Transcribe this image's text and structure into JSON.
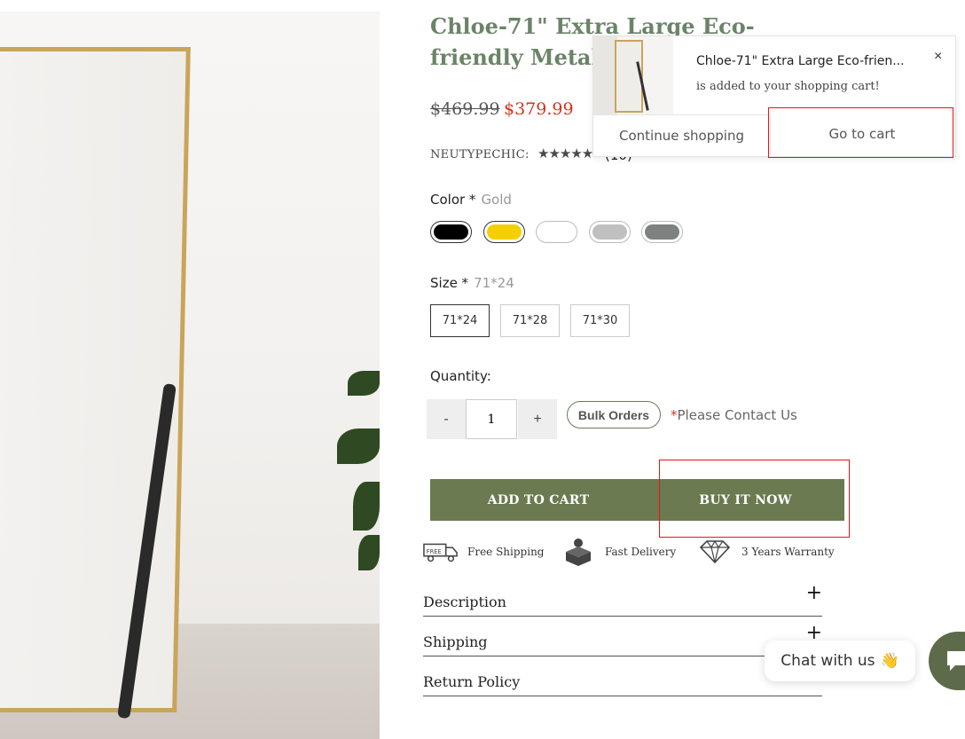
{
  "product": {
    "title": "Chloe-71\" Extra Large Eco-friendly Metal Framed Fu",
    "price_old": "$469.99",
    "price_new": "$379.99",
    "vendor": "NEUTYPECHIC:",
    "rating": 5,
    "stars": "★★★★★",
    "review_count": "(10)"
  },
  "color": {
    "label": "Color *",
    "selected": "Gold",
    "swatches": [
      {
        "name": "Black",
        "hex": "#000000"
      },
      {
        "name": "Gold",
        "hex": "#f5d000"
      },
      {
        "name": "White",
        "hex": "#ffffff"
      },
      {
        "name": "Silver",
        "hex": "#c0c0c0"
      },
      {
        "name": "Gray",
        "hex": "#7e8180"
      }
    ]
  },
  "size": {
    "label": "Size *",
    "selected": "71*24",
    "options": [
      "71*24",
      "71*28",
      "71*30"
    ]
  },
  "quantity": {
    "label": "Quantity:",
    "value": "1",
    "minus": "-",
    "plus": "+"
  },
  "bulk": {
    "button": "Bulk Orders",
    "asterisk": "*",
    "contact": "Please Contact Us"
  },
  "actions": {
    "add_to_cart": "ADD TO CART",
    "buy_now": "BUY IT NOW"
  },
  "perks": [
    {
      "icon": "truck-icon",
      "label": "Free Shipping"
    },
    {
      "icon": "box-icon",
      "label": "Fast Delivery"
    },
    {
      "icon": "diamond-icon",
      "label": "3 Years Warranty"
    }
  ],
  "accordion": [
    {
      "label": "Description",
      "toggle": "+"
    },
    {
      "label": "Shipping",
      "toggle": "+"
    },
    {
      "label": "Return Policy",
      "toggle": "+"
    }
  ],
  "cart_popup": {
    "product_name": "Chloe-71\" Extra Large Eco-frien...",
    "message": "is added to your shopping cart!",
    "close": "×",
    "continue": "Continue shopping",
    "go_to_cart": "Go to cart"
  },
  "chat": {
    "label": "Chat with us",
    "emoji": "👋"
  },
  "colors": {
    "accent": "#6b7a50",
    "title": "#6b8468",
    "sale": "#d9301e",
    "highlight": "#e11111"
  }
}
